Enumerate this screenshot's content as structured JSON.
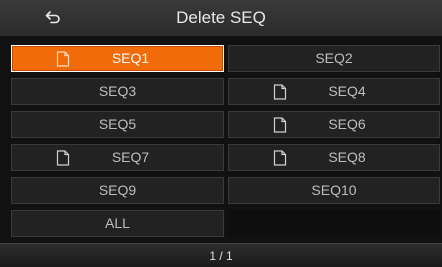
{
  "header": {
    "title": "Delete SEQ",
    "back_icon": "back-arrow-icon"
  },
  "grid": {
    "items": [
      {
        "label": "SEQ1",
        "has_file": true,
        "selected": true
      },
      {
        "label": "SEQ2",
        "has_file": false,
        "selected": false
      },
      {
        "label": "SEQ3",
        "has_file": false,
        "selected": false
      },
      {
        "label": "SEQ4",
        "has_file": true,
        "selected": false
      },
      {
        "label": "SEQ5",
        "has_file": false,
        "selected": false
      },
      {
        "label": "SEQ6",
        "has_file": true,
        "selected": false
      },
      {
        "label": "SEQ7",
        "has_file": true,
        "selected": false
      },
      {
        "label": "SEQ8",
        "has_file": true,
        "selected": false
      },
      {
        "label": "SEQ9",
        "has_file": false,
        "selected": false
      },
      {
        "label": "SEQ10",
        "has_file": false,
        "selected": false
      },
      {
        "label": "ALL",
        "has_file": false,
        "selected": false
      }
    ]
  },
  "footer": {
    "page_indicator": "1 / 1"
  },
  "colors": {
    "accent": "#f26b0a",
    "cell_bg": "#222222",
    "text": "#bdbdbd"
  }
}
